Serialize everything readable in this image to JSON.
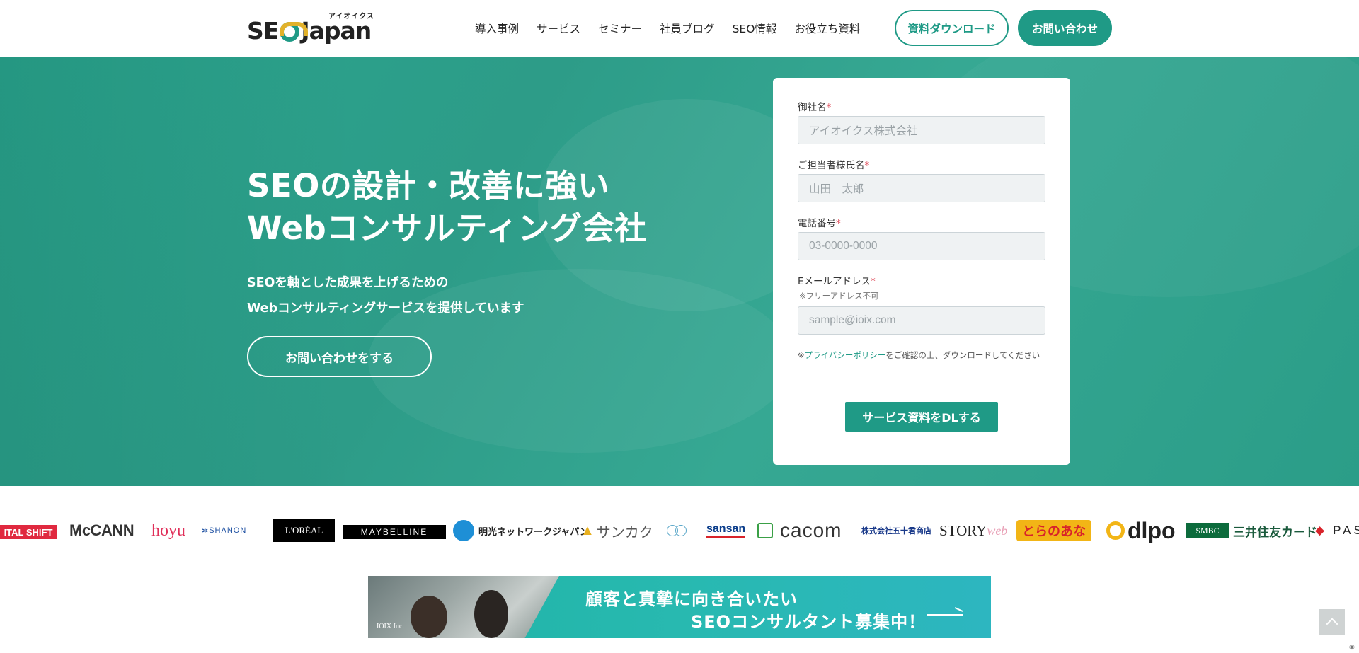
{
  "header": {
    "logo_text": "SEOJapan",
    "logo_kana": "アイオイクス",
    "nav": [
      "導入事例",
      "サービス",
      "セミナー",
      "社員ブログ",
      "SEO情報",
      "お役立ち資料"
    ],
    "download_button": "資料ダウンロード",
    "contact_button": "お問い合わせ"
  },
  "hero": {
    "title_line1": "SEOの設計・改善に強い",
    "title_line2": "Webコンサルティング会社",
    "sub_line1": "SEOを軸とした成果を上げるための",
    "sub_line2": "Webコンサルティングサービスを提供しています",
    "cta": "お問い合わせをする"
  },
  "form": {
    "company_label": "御社名",
    "company_placeholder": "アイオイクス株式会社",
    "name_label": "ご担当者様氏名",
    "name_placeholder": "山田　太郎",
    "phone_label": "電話番号",
    "phone_placeholder": "03-0000-0000",
    "email_label": "Eメールアドレス",
    "email_note": "※フリーアドレス不可",
    "email_placeholder": "sample@ioix.com",
    "required_mark": "*",
    "privacy_prefix": "※",
    "privacy_link": "プライバシーポリシー",
    "privacy_suffix": "をご確認の上、ダウンロードしてください",
    "submit": "サービス資料をDLする"
  },
  "client_logos": [
    "ITAL SHIFT",
    "McCANN",
    "hoyu",
    "SHANON",
    "L'ORÉAL",
    "MAYBELLINE",
    "明光ネットワークジャパン",
    "サンカク",
    "sansan",
    "cacom",
    "株式会社五十君商店",
    "STORY",
    "とらのあな",
    "dlpo",
    "SMBC",
    "三井住友カード",
    "PAS"
  ],
  "banner": {
    "line1": "顧客と真摯に向き合いたい",
    "line2": "SEOコンサルタント募集中！",
    "inc": "IOIX Inc."
  },
  "colors": {
    "brand": "#1f9a86",
    "hero_bg": "#2aa58e",
    "banner_bg": "#28b9b0"
  }
}
